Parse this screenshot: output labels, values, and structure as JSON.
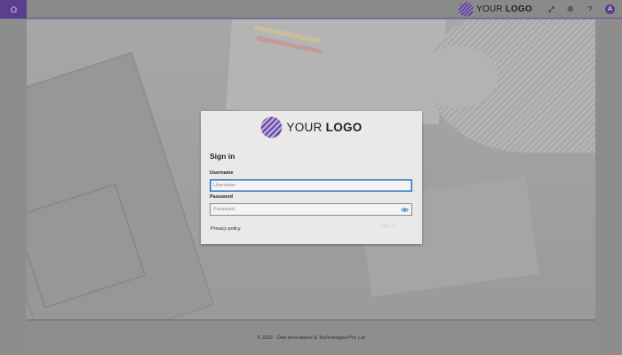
{
  "topbar": {
    "home_icon": "home-icon",
    "brand": {
      "text_regular": "YOUR ",
      "text_bold": "LOGO"
    },
    "icons": [
      "expand-icon",
      "gear-icon",
      "help-icon"
    ],
    "help_glyph": "?",
    "avatar_letter": "A"
  },
  "dialog": {
    "logo": {
      "text_regular": "YOUR ",
      "text_bold": "LOGO"
    },
    "title": "Sign in",
    "username_label": "Username",
    "username_placeholder": "Username",
    "password_label": "Password",
    "password_placeholder": "Password",
    "privacy_link": "Privacy policy",
    "signin_button": "Sign in"
  },
  "footer": {
    "text": "© 2022 - Dart Innovations & Technologies Pvt. Ltd"
  },
  "colors": {
    "accent": "#5a3f8c",
    "focus": "#2f6fb7"
  }
}
